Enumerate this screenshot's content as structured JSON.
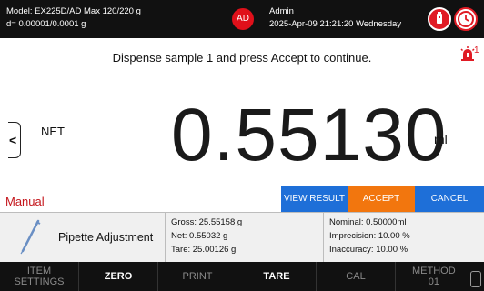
{
  "header": {
    "model_line": "Model: EX225D/AD   Max 120/220 g",
    "resolution_line": "d= 0.00001/0.0001 g",
    "avatar_initials": "AD",
    "user_name": "Admin",
    "datetime": "2025-Apr-09 21:21:20 Wednesday"
  },
  "instruction": "Dispense sample 1 and press Accept to continue.",
  "alarm": {
    "count": "1"
  },
  "display": {
    "mode_label": "NET",
    "weight": "0.55130",
    "unit": "ml"
  },
  "status": {
    "mode": "Manual"
  },
  "actions": {
    "view_result": "VIEW RESULT",
    "accept": "ACCEPT",
    "cancel": "CANCEL"
  },
  "info": {
    "method_name": "Pipette Adjustment",
    "gross": "Gross: 25.55158  g",
    "net": "Net: 0.55032  g",
    "tare": "Tare: 25.00126  g",
    "nominal": "Nominal: 0.50000ml",
    "imprecision": "Imprecision: 10.00 %",
    "inaccuracy": "Inaccuracy: 10.00 %"
  },
  "bottom_bar": {
    "item_settings_1": "ITEM",
    "item_settings_2": "SETTINGS",
    "zero": "ZERO",
    "print": "PRINT",
    "tare": "TARE",
    "cal": "CAL",
    "method_1": "METHOD",
    "method_2": "01"
  },
  "colors": {
    "accent_blue": "#1e6fd8",
    "accent_orange": "#f2760e",
    "alert_red": "#e01b24",
    "mode_red": "#c4161c"
  },
  "icons": [
    "usb-icon",
    "timer-icon",
    "alarm-icon",
    "left-arrow-icon",
    "pipette-icon",
    "edit-icon"
  ]
}
